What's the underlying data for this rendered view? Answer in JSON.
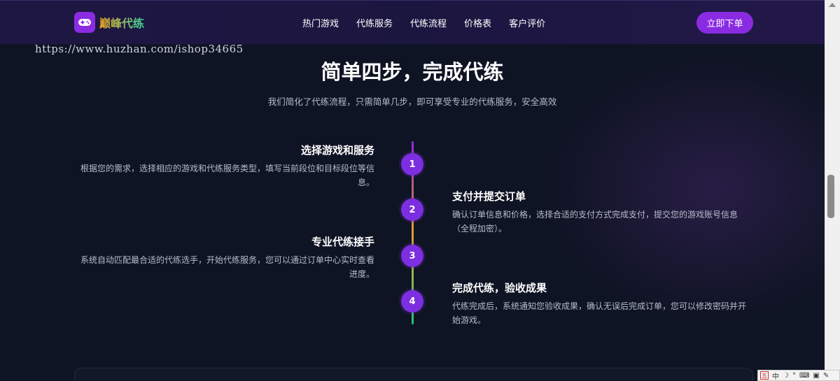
{
  "header": {
    "brand_name": "巅峰代练",
    "nav_items": [
      "热门游戏",
      "代练服务",
      "代练流程",
      "价格表",
      "客户评价"
    ],
    "cta_label": "立即下单"
  },
  "watermark": "https://www.huzhan.com/ishop34665",
  "section": {
    "title": "简单四步，完成代练",
    "subtitle": "我们简化了代练流程，只需简单几步，即可享受专业的代练服务，安全高效"
  },
  "steps": [
    {
      "number": "1",
      "title": "选择游戏和服务",
      "desc": "根据您的需求，选择相应的游戏和代练服务类型，填写当前段位和目标段位等信息。"
    },
    {
      "number": "2",
      "title": "支付并提交订单",
      "desc": "确认订单信息和价格，选择合适的支付方式完成支付，提交您的游戏账号信息（全程加密）。"
    },
    {
      "number": "3",
      "title": "专业代练接手",
      "desc": "系统自动匹配最合适的代练选手，开始代练服务，您可以通过订单中心实时查看进度。"
    },
    {
      "number": "4",
      "title": "完成代练，验收成果",
      "desc": "代练完成后，系统通知您验收成果，确认无误后完成订单，您可以修改密码并开始游戏。"
    }
  ],
  "ime": {
    "logo": "五",
    "mode": "中"
  },
  "icons": {
    "logo": "gamepad-icon"
  },
  "colors": {
    "accent": "#8a2be2",
    "background": "#0f1424",
    "header_bg": "#1f1743"
  }
}
